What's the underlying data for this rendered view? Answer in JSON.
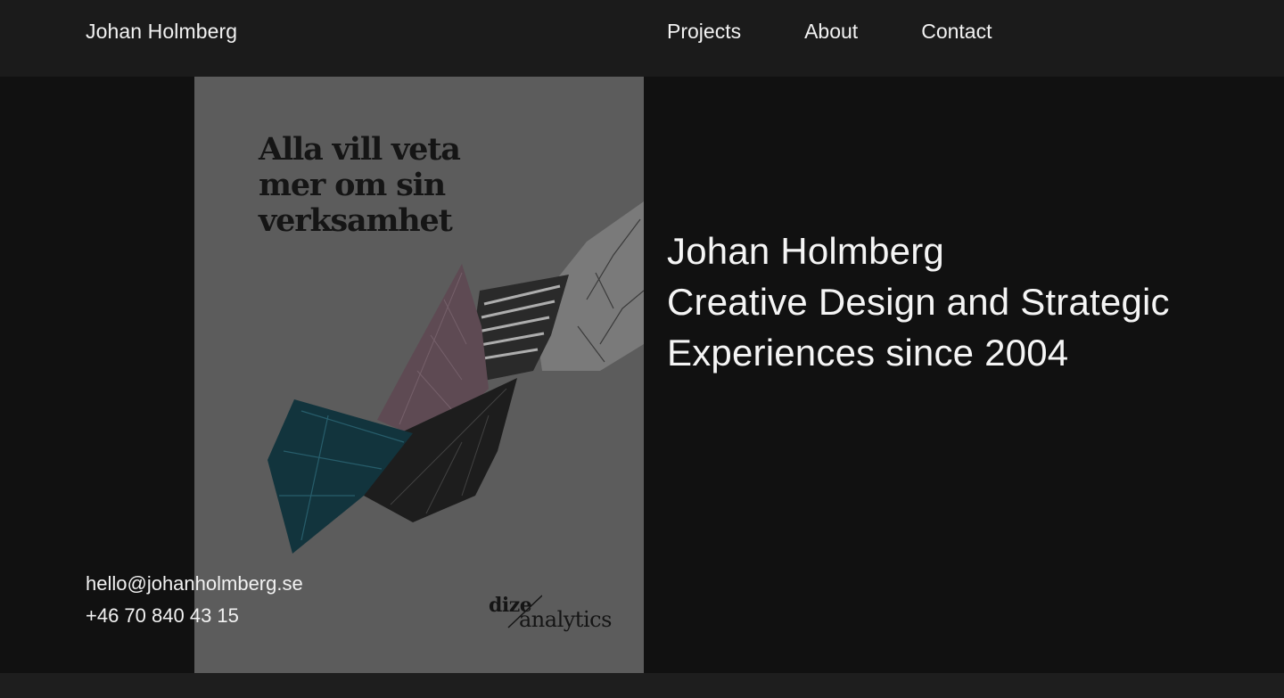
{
  "header": {
    "brand": "Johan Holmberg",
    "nav": [
      {
        "label": "Projects"
      },
      {
        "label": "About"
      },
      {
        "label": "Contact"
      }
    ]
  },
  "poster": {
    "headline": "Alla vill veta\nmer om sin\nverksamhet",
    "logo_word1": "dize",
    "logo_word2": "analytics"
  },
  "hero": {
    "tagline_lines": [
      "Johan Holmberg",
      "Creative Design and Strategic",
      "Experiences since 2004"
    ]
  },
  "contact": {
    "email": "hello@johanholmberg.se",
    "phone": "+46 70 840 43 15"
  },
  "colors": {
    "header_bg": "#1b1b1b",
    "hero_bg": "#111111",
    "poster_bg": "#5c5c5c",
    "text": "#f2f2f2"
  }
}
